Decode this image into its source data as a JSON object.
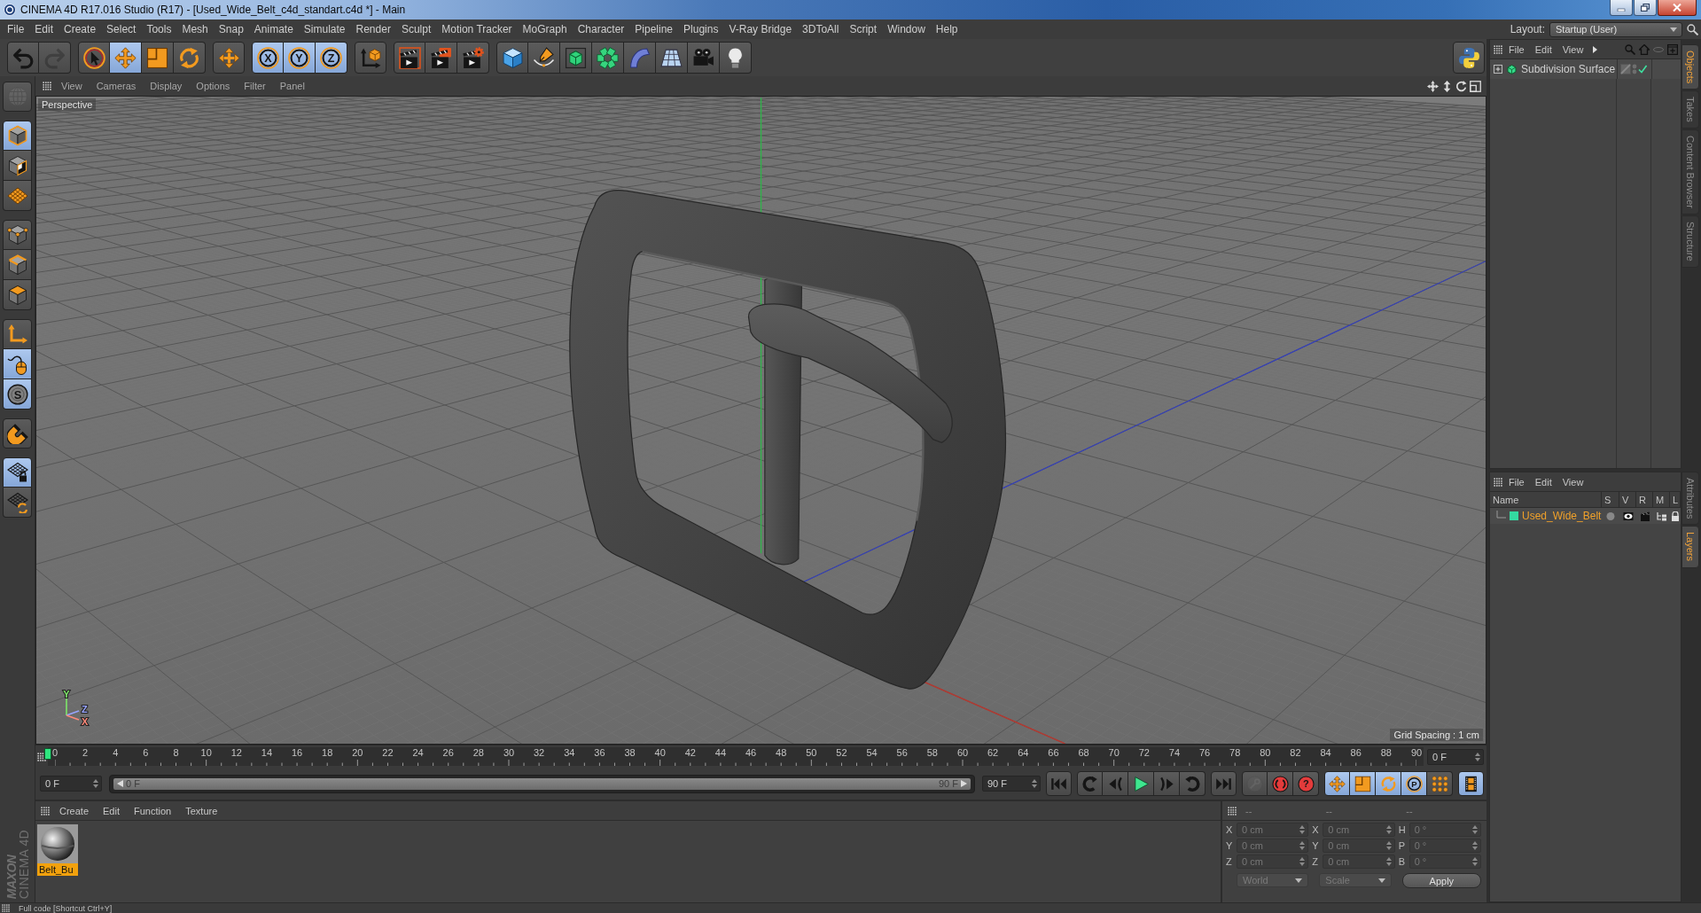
{
  "window": {
    "title": "CINEMA 4D R17.016 Studio (R17) - [Used_Wide_Belt_c4d_standart.c4d *] - Main"
  },
  "menu_bar": {
    "items": [
      "File",
      "Edit",
      "Create",
      "Select",
      "Tools",
      "Mesh",
      "Snap",
      "Animate",
      "Simulate",
      "Render",
      "Sculpt",
      "Motion Tracker",
      "MoGraph",
      "Character",
      "Pipeline",
      "Plugins",
      "V-Ray Bridge",
      "3DToAll",
      "Script",
      "Window",
      "Help"
    ],
    "layout_label": "Layout:",
    "layout_value": "Startup (User)"
  },
  "toolbar": {
    "groups": [
      [
        {
          "kind": "undo",
          "active": false,
          "disabled": false
        },
        {
          "kind": "redo",
          "active": false,
          "disabled": true
        }
      ],
      [
        {
          "kind": "select",
          "active": false
        },
        {
          "kind": "move",
          "active": true
        },
        {
          "kind": "scale",
          "active": false
        },
        {
          "kind": "rotate",
          "active": false
        }
      ],
      [
        {
          "kind": "transform",
          "active": false
        }
      ],
      [
        {
          "kind": "axislock",
          "label": "X",
          "active": true
        },
        {
          "kind": "axislock",
          "label": "Y",
          "active": true
        },
        {
          "kind": "axislock",
          "label": "Z",
          "active": true
        }
      ],
      [
        {
          "kind": "coordsystem",
          "active": false
        }
      ],
      [
        {
          "kind": "renderview",
          "active": false
        },
        {
          "kind": "renderpicture",
          "active": false
        },
        {
          "kind": "rendersettings",
          "active": false
        }
      ],
      [
        {
          "kind": "cube",
          "active": false
        },
        {
          "kind": "pen",
          "active": false
        },
        {
          "kind": "subdivision",
          "active": false
        },
        {
          "kind": "cloner",
          "active": false
        },
        {
          "kind": "bend",
          "active": false
        },
        {
          "kind": "floor",
          "active": false
        },
        {
          "kind": "camera",
          "active": false
        },
        {
          "kind": "light",
          "active": false
        }
      ]
    ],
    "end": [
      {
        "kind": "script",
        "active": false
      }
    ]
  },
  "left_toolbar": {
    "groups": [
      [
        {
          "kind": "editable",
          "active": false,
          "disabled": true
        }
      ],
      [
        {
          "kind": "model",
          "active": true
        },
        {
          "kind": "texture",
          "active": false
        },
        {
          "kind": "workplane",
          "active": false
        }
      ],
      [
        {
          "kind": "points",
          "active": false
        },
        {
          "kind": "edges",
          "active": false
        },
        {
          "kind": "polygons",
          "active": false
        }
      ],
      [
        {
          "kind": "axismode",
          "active": false
        },
        {
          "kind": "tweak",
          "active": true
        },
        {
          "kind": "solo",
          "label": "S",
          "active": true
        }
      ],
      [
        {
          "kind": "snap",
          "active": false
        }
      ],
      [
        {
          "kind": "lockplane",
          "active": true
        },
        {
          "kind": "gridrotate",
          "active": false
        }
      ]
    ],
    "branding": {
      "brand": "MAXON",
      "product": "CINEMA 4D"
    }
  },
  "viewport": {
    "menu": [
      "View",
      "Cameras",
      "Display",
      "Options",
      "Filter",
      "Panel"
    ],
    "camera": "Perspective",
    "grid_info": "Grid Spacing : 1 cm",
    "gizmo": [
      {
        "label": "Y",
        "color": "#7ee86a"
      },
      {
        "label": "Z",
        "color": "#98a4ff"
      },
      {
        "label": "X",
        "color": "#ff8a7a"
      }
    ]
  },
  "timeline": {
    "ticks": [
      "0",
      "2",
      "4",
      "6",
      "8",
      "10",
      "12",
      "14",
      "16",
      "18",
      "20",
      "22",
      "24",
      "26",
      "28",
      "30",
      "32",
      "34",
      "36",
      "38",
      "40",
      "42",
      "44",
      "46",
      "48",
      "50",
      "52",
      "54",
      "56",
      "58",
      "60",
      "62",
      "64",
      "66",
      "68",
      "70",
      "72",
      "74",
      "76",
      "78",
      "80",
      "82",
      "84",
      "86",
      "88",
      "90"
    ],
    "playhead": {
      "level": 0
    },
    "frame": "0 F"
  },
  "transport": {
    "start_field": "0 F",
    "range": {
      "start": "0 F",
      "end": "90 F",
      "level": 1
    },
    "end_field": "90 F",
    "groups": [
      [
        {
          "kind": "tostart",
          "active": false
        }
      ],
      [
        {
          "kind": "prevkey",
          "active": false
        },
        {
          "kind": "prevframe",
          "active": false
        },
        {
          "kind": "play",
          "active": false
        },
        {
          "kind": "nextframe",
          "active": false
        },
        {
          "kind": "nextkey",
          "active": false
        }
      ],
      [
        {
          "kind": "toend",
          "active": false
        }
      ],
      [
        {
          "kind": "record",
          "active": false,
          "disabled": true
        },
        {
          "kind": "autokey",
          "active": false,
          "disabled": false
        },
        {
          "kind": "keysel",
          "label": "?",
          "active": false,
          "disabled": false
        }
      ],
      [
        {
          "kind": "keymove",
          "active": true
        },
        {
          "kind": "keyscale",
          "active": true
        },
        {
          "kind": "keyrotate",
          "active": true
        },
        {
          "kind": "keyparam",
          "label": "P",
          "active": true
        },
        {
          "kind": "keypoints",
          "active": false
        }
      ],
      [
        {
          "kind": "timeline",
          "active": true
        }
      ]
    ]
  },
  "materials": {
    "menu": [
      "Create",
      "Edit",
      "Function",
      "Texture"
    ],
    "items": [
      {
        "name": "Belt_Bu",
        "selected": true
      }
    ]
  },
  "coordinates": {
    "headers": [
      "--",
      "--",
      "--"
    ],
    "rows": [
      [
        {
          "axis": "X",
          "value": "0 cm"
        },
        {
          "axis": "X",
          "value": "0 cm"
        },
        {
          "axis": "H",
          "value": "0 °"
        }
      ],
      [
        {
          "axis": "Y",
          "value": "0 cm"
        },
        {
          "axis": "Y",
          "value": "0 cm"
        },
        {
          "axis": "P",
          "value": "0 °"
        }
      ],
      [
        {
          "axis": "Z",
          "value": "0 cm"
        },
        {
          "axis": "Z",
          "value": "0 cm"
        },
        {
          "axis": "B",
          "value": "0 °"
        }
      ]
    ],
    "dropdowns": [
      "World",
      "Scale"
    ],
    "apply": "Apply"
  },
  "objects": {
    "menu": [
      "File",
      "Edit",
      "View"
    ],
    "rows": [
      {
        "name": "Subdivision Surface",
        "expanded": false,
        "enabled": true
      }
    ]
  },
  "layers": {
    "menu": [
      "File",
      "Edit",
      "View"
    ],
    "columns": [
      "Name",
      "S",
      "V",
      "R",
      "M",
      "L"
    ],
    "rows": [
      {
        "name": "Used_Wide_Belt",
        "color": "#34d9a0"
      }
    ]
  },
  "side_tabs": {
    "upper": [
      {
        "label": "Objects",
        "selected": true
      },
      {
        "label": "Takes",
        "selected": false
      },
      {
        "label": "Content Browser",
        "selected": false
      },
      {
        "label": "Structure",
        "selected": false
      }
    ],
    "lower": [
      {
        "label": "Attributes",
        "selected": false
      },
      {
        "label": "Layers",
        "selected": true
      }
    ]
  },
  "status_bar": {
    "text": "Full code [Shortcut Ctrl+Y]"
  }
}
